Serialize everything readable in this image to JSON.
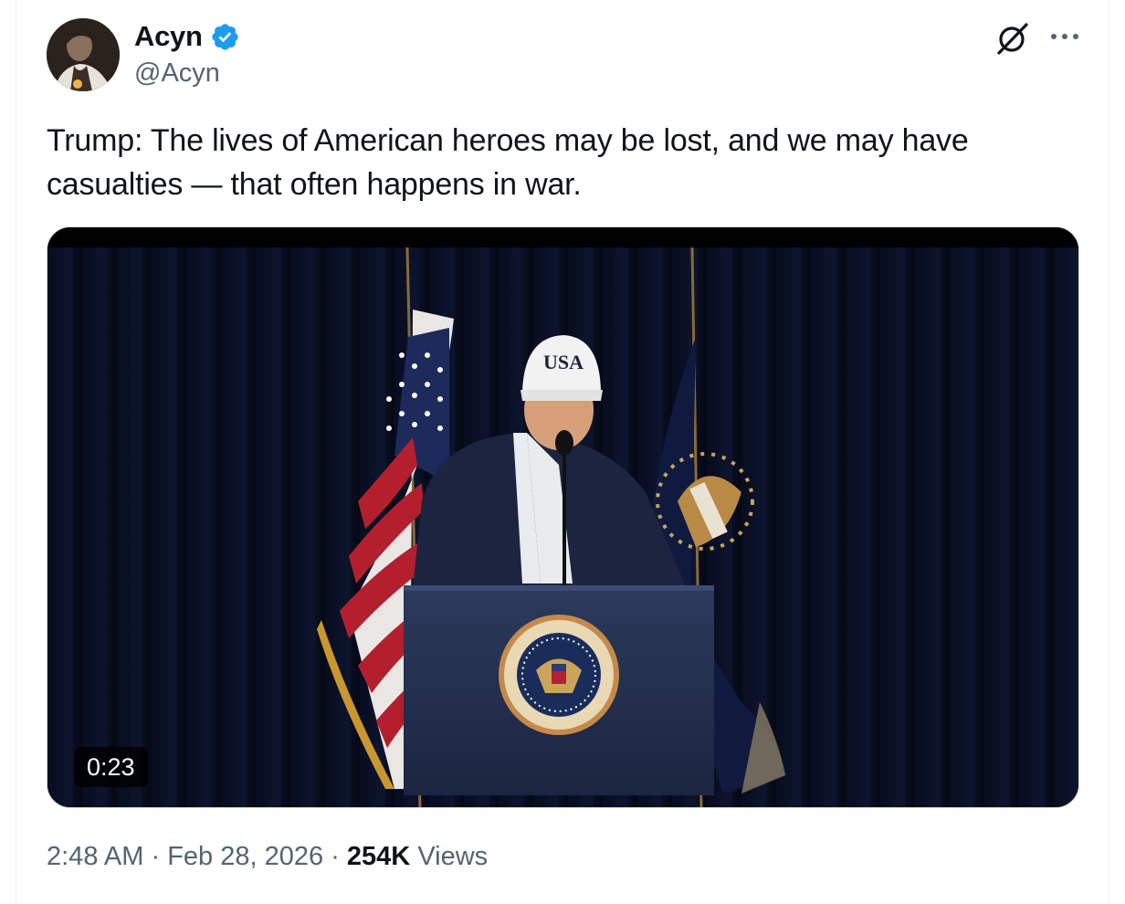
{
  "author": {
    "name": "Acyn",
    "handle": "@Acyn",
    "verified": true,
    "verified_color": "#1d9bf0"
  },
  "tweet": {
    "text": "Trump: The lives of American heroes may be lost, and we may have casualties — that often happens in war."
  },
  "media": {
    "type": "video",
    "duration": "0:23",
    "hat_text": "USA"
  },
  "meta": {
    "time": "2:48 AM",
    "separator": "·",
    "date": "Feb 28, 2026",
    "views_count": "254K",
    "views_label": "Views"
  },
  "icons": [
    "verified-badge-icon",
    "grok-icon",
    "more-icon"
  ]
}
